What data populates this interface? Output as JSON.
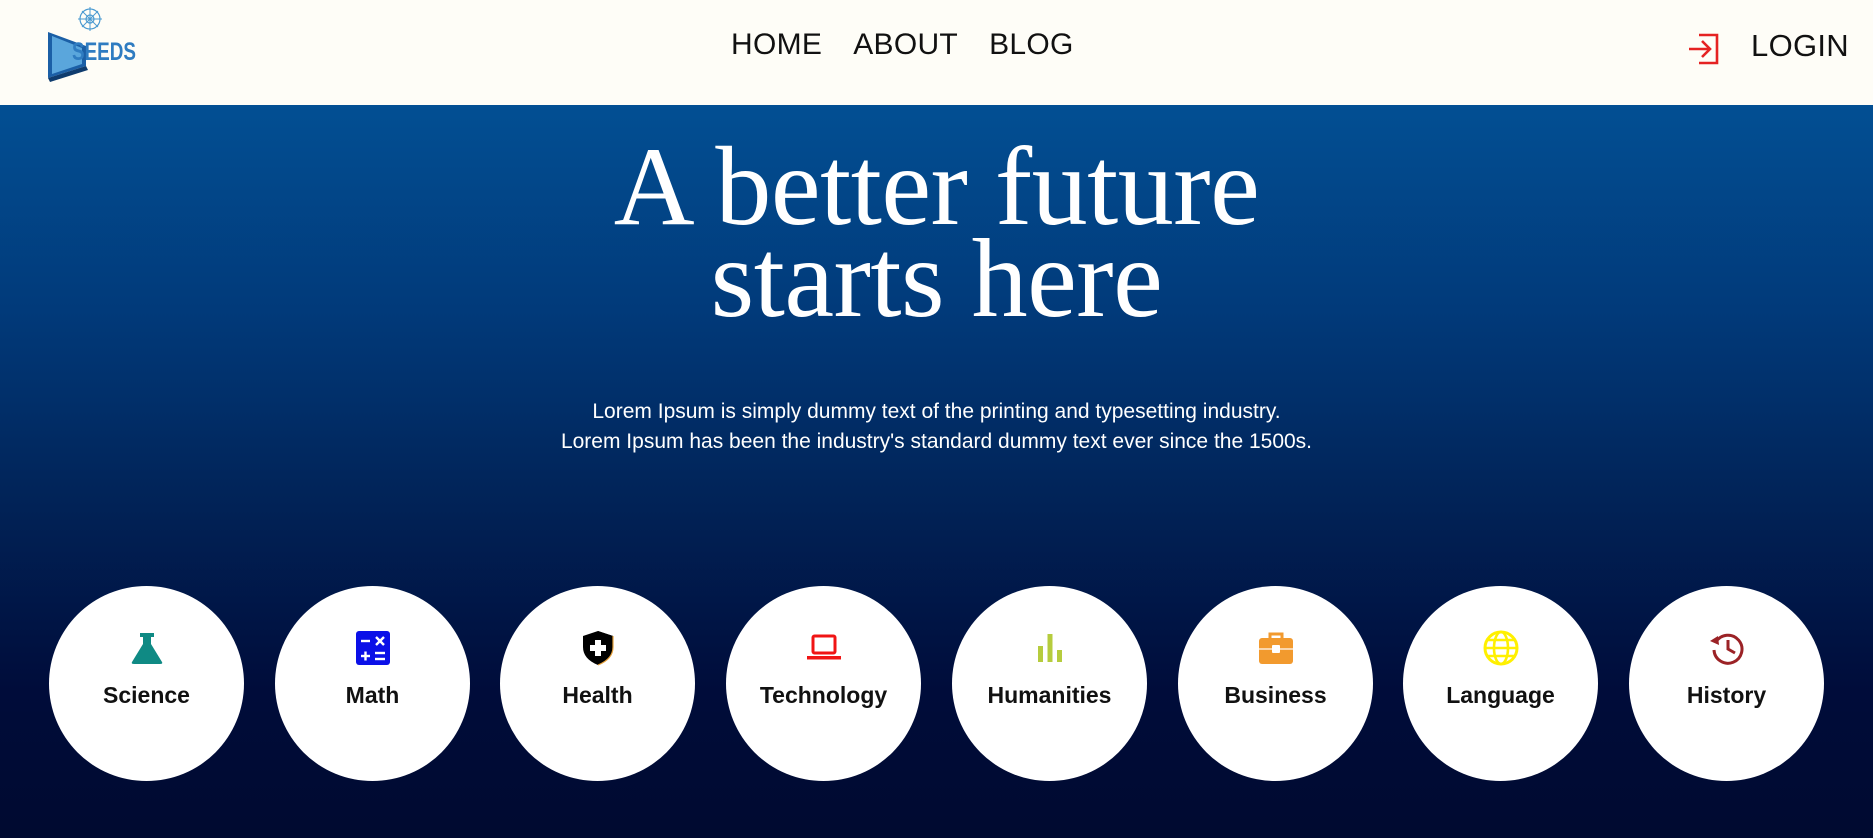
{
  "brand": {
    "logo_text": "SEEDS"
  },
  "nav": {
    "items": [
      "HOME",
      "ABOUT",
      "BLOG"
    ],
    "login_label": "LOGIN"
  },
  "hero": {
    "headline_line1": "A better future",
    "headline_line2": "starts here",
    "sub_line1": "Lorem Ipsum is simply dummy text of the printing and typesetting industry.",
    "sub_line2": "Lorem Ipsum has been the industry's standard dummy text ever since the 1500s."
  },
  "categories": [
    {
      "label": "Science",
      "icon": "flask-icon",
      "color": "#0f8a84"
    },
    {
      "label": "Math",
      "icon": "calculator-icon",
      "color": "#0b10e8"
    },
    {
      "label": "Health",
      "icon": "shield-plus-icon",
      "color": "#000000"
    },
    {
      "label": "Technology",
      "icon": "laptop-icon",
      "color": "#f01414"
    },
    {
      "label": "Humanities",
      "icon": "bar-chart-icon",
      "color": "#b6cc3d"
    },
    {
      "label": "Business",
      "icon": "briefcase-icon",
      "color": "#f29a2e"
    },
    {
      "label": "Language",
      "icon": "globe-icon",
      "color": "#fff000"
    },
    {
      "label": "History",
      "icon": "history-icon",
      "color": "#9b2226"
    }
  ],
  "colors": {
    "topbar_bg": "#fefdf7",
    "hero_top": "#024f93",
    "hero_bottom": "#000a30",
    "login_icon": "#e52222"
  }
}
